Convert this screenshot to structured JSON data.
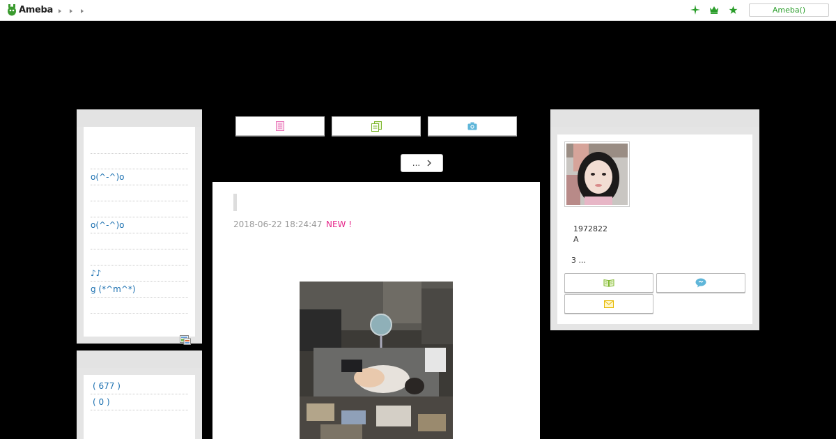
{
  "topbar": {
    "logo_text": "Ameba",
    "login_label": "Ameba()",
    "icons": [
      "sparkle-icon",
      "crown-icon",
      "star-icon"
    ]
  },
  "left_sidebar": {
    "links": [
      "",
      "o(^-^)o",
      "",
      "",
      " o(^-^)o",
      "",
      "",
      "♪♪",
      "g  (*^m^*)",
      ""
    ],
    "theme_counts": [
      "( 677 )",
      "( 0 )"
    ]
  },
  "nav_buttons": [
    "memo-icon",
    "copy-icon",
    "camera-icon"
  ],
  "more_button": {
    "label": "..."
  },
  "article": {
    "date": "2018-06-22 18:24:47",
    "new_badge": "NEW !"
  },
  "profile": {
    "id_number": "1972822",
    "line2": "A",
    "more": "3 ...",
    "buttons": [
      "book-icon",
      "chat-icon",
      "mail-icon"
    ]
  },
  "colors": {
    "accent_green": "#2a9d2a",
    "link_blue": "#1a6fb0",
    "new_pink": "#e6268a"
  }
}
